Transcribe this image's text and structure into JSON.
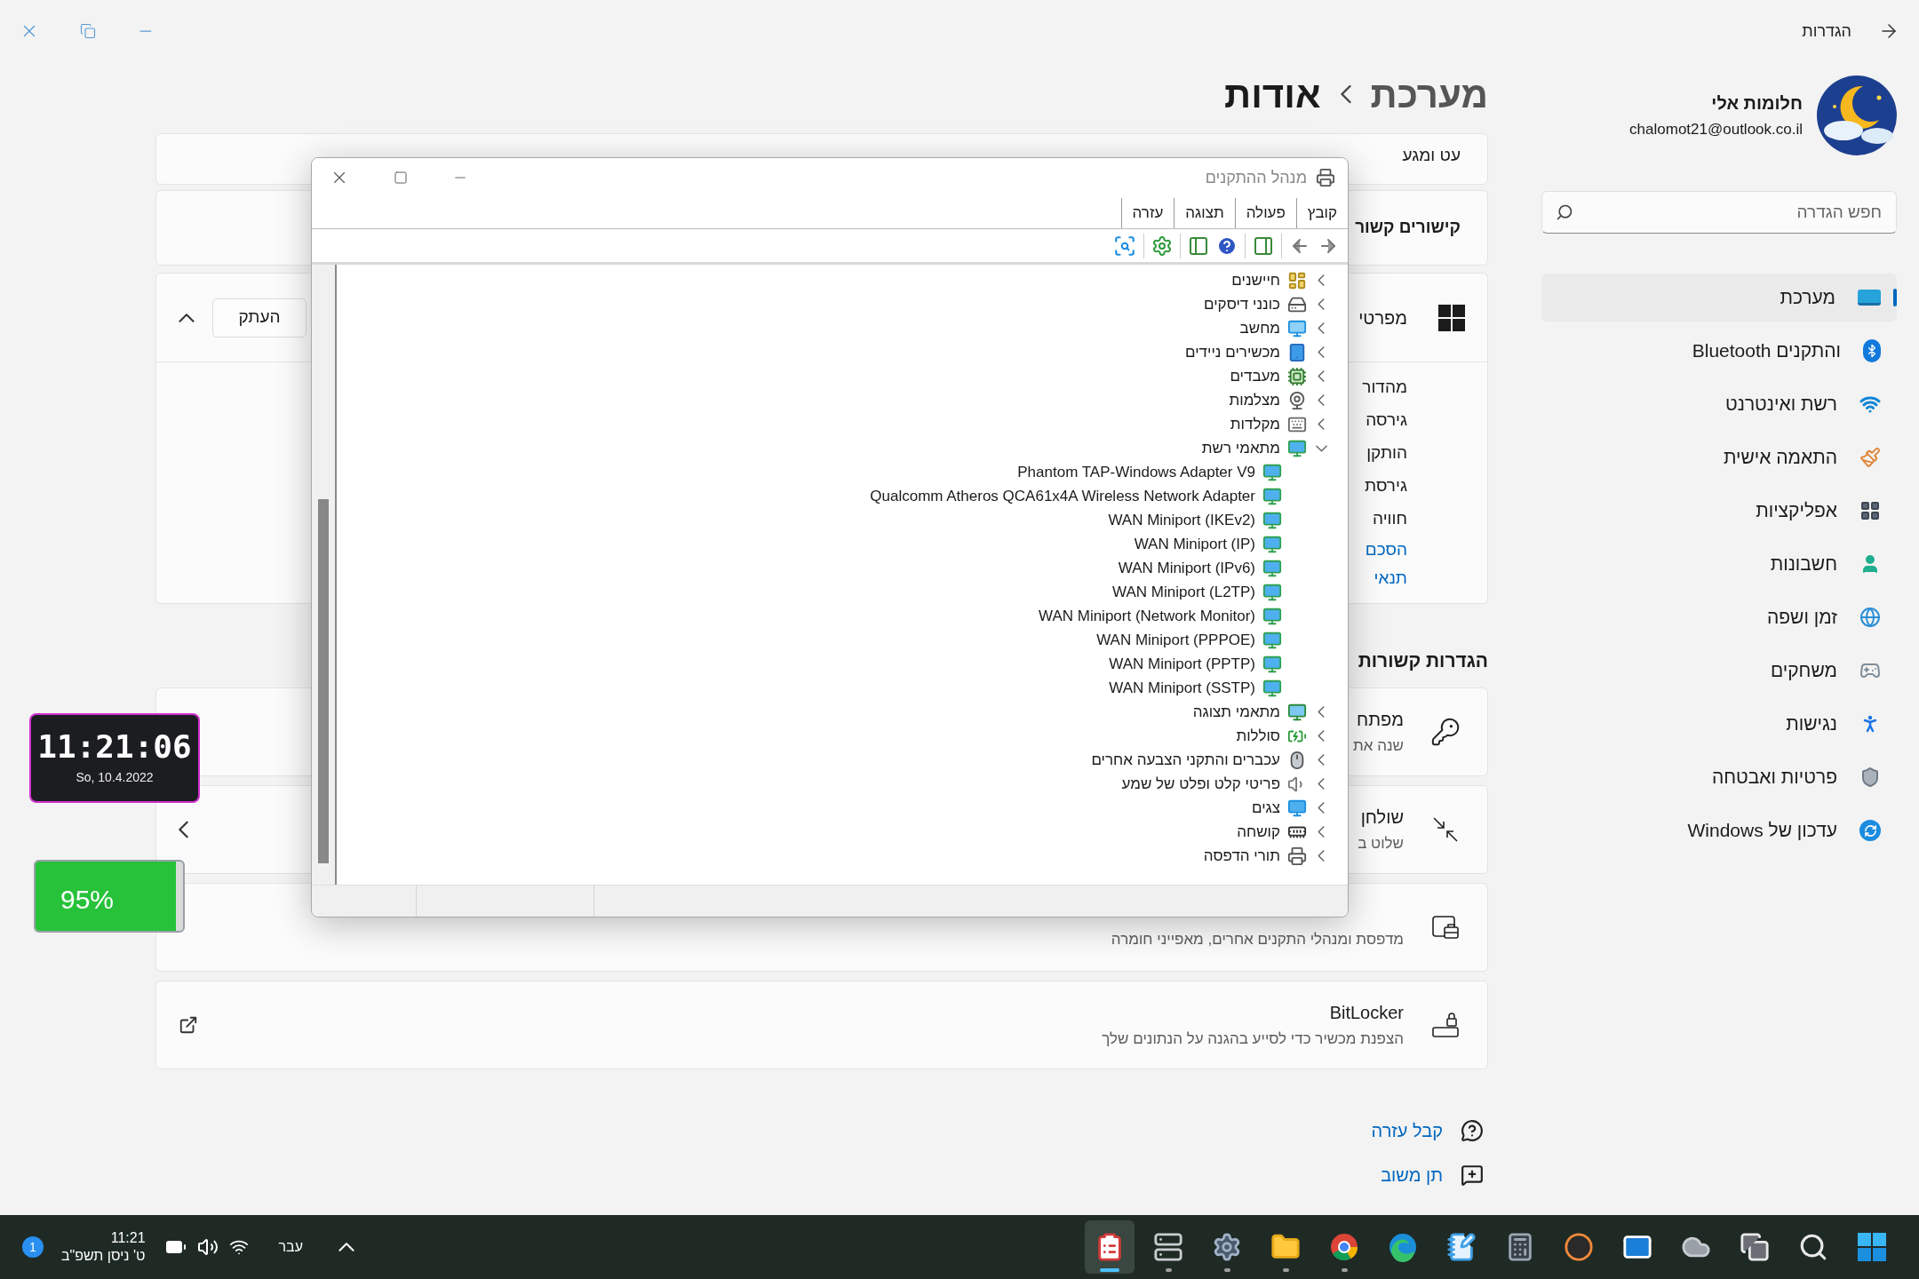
{
  "window": {
    "title": "הגדרות"
  },
  "profile": {
    "name": "חלומות אלי",
    "email": "chalomot21@outlook.co.il"
  },
  "search": {
    "placeholder": "חפש הגדרה"
  },
  "nav": [
    {
      "kind": "system",
      "label": "מערכת",
      "selected": true
    },
    {
      "kind": "bluetooth",
      "label": "Bluetooth והתקנים",
      "selected": false
    },
    {
      "kind": "network",
      "label": "רשת ואינטרנט",
      "selected": false
    },
    {
      "kind": "personalization",
      "label": "התאמה אישית",
      "selected": false
    },
    {
      "kind": "apps",
      "label": "אפליקציות",
      "selected": false
    },
    {
      "kind": "accounts",
      "label": "חשבונות",
      "selected": false
    },
    {
      "kind": "time",
      "label": "זמן ושפה",
      "selected": false
    },
    {
      "kind": "gaming",
      "label": "משחקים",
      "selected": false
    },
    {
      "kind": "accessibility",
      "label": "נגישות",
      "selected": false
    },
    {
      "kind": "privacy",
      "label": "פרטיות ואבטחה",
      "selected": false
    },
    {
      "kind": "update",
      "label": "עדכון של Windows",
      "selected": false
    }
  ],
  "breadcrumb": {
    "parent": "מערכת",
    "current": "אודות"
  },
  "pen_card": {
    "title": "עט ומגע"
  },
  "links_card": {
    "title": "קישורים קשור"
  },
  "specs": {
    "title": "מפרטי",
    "copy_button": "העתק",
    "expanded": true,
    "rows": [
      "מהדור",
      "גירסה",
      "הותקן",
      "גירסת",
      "חוויה"
    ],
    "links": [
      "הסכם",
      "תנאי"
    ]
  },
  "related_settings": {
    "heading": "הגדרות קשורות",
    "items": [
      {
        "kind": "key",
        "title": "מפתח",
        "subtitle": "שנה את"
      },
      {
        "kind": "remote",
        "title": "שולחן",
        "subtitle": "שלוט ב"
      },
      {
        "kind": "device-manager",
        "subtitle": "מדפסת ומנהלי התקנים אחרים, מאפייני חומרה"
      },
      {
        "kind": "bitlocker",
        "title": "BitLocker",
        "subtitle": "הצפנת מכשיר כדי לסייע בהגנה על הנתונים שלך"
      }
    ]
  },
  "help_links": [
    {
      "kind": "help",
      "label": "קבל עזרה"
    },
    {
      "kind": "feedback",
      "label": "תן משוב"
    }
  ],
  "device_manager": {
    "title": "מנהל ההתקנים",
    "menu": [
      "קובץ",
      "פעולה",
      "תצוגה",
      "עזרה"
    ],
    "tree": [
      {
        "kind": "sensor",
        "label": "חיישנים",
        "expanded": false
      },
      {
        "kind": "disk",
        "label": "כונני דיסקים",
        "expanded": false
      },
      {
        "kind": "computer",
        "label": "מחשב",
        "expanded": false
      },
      {
        "kind": "portable",
        "label": "מכשירים ניידים",
        "expanded": false
      },
      {
        "kind": "processor",
        "label": "מעבדים",
        "expanded": false
      },
      {
        "kind": "camera",
        "label": "מצלמות",
        "expanded": false
      },
      {
        "kind": "keyboard",
        "label": "מקלדות",
        "expanded": false
      },
      {
        "kind": "network",
        "label": "מתאמי רשת",
        "expanded": true,
        "children": [
          {
            "kind": "network",
            "label": "Phantom TAP-Windows Adapter V9"
          },
          {
            "kind": "network",
            "label": "Qualcomm Atheros QCA61x4A Wireless Network Adapter"
          },
          {
            "kind": "network",
            "label": "WAN Miniport (IKEv2)"
          },
          {
            "kind": "network",
            "label": "WAN Miniport (IP)"
          },
          {
            "kind": "network",
            "label": "WAN Miniport (IPv6)"
          },
          {
            "kind": "network",
            "label": "WAN Miniport (L2TP)"
          },
          {
            "kind": "network",
            "label": "WAN Miniport (Network Monitor)"
          },
          {
            "kind": "network",
            "label": "WAN Miniport (PPPOE)"
          },
          {
            "kind": "network",
            "label": "WAN Miniport (PPTP)"
          },
          {
            "kind": "network",
            "label": "WAN Miniport (SSTP)"
          }
        ]
      },
      {
        "kind": "display",
        "label": "מתאמי תצוגה",
        "expanded": false
      },
      {
        "kind": "battery",
        "label": "סוללות",
        "expanded": false
      },
      {
        "kind": "mouse",
        "label": "עכברים והתקני הצבעה אחרים",
        "expanded": false
      },
      {
        "kind": "audio",
        "label": "פריטי קלט ופלט של שמע",
        "expanded": false
      },
      {
        "kind": "monitor",
        "label": "צגים",
        "expanded": false
      },
      {
        "kind": "firmware",
        "label": "קושחה",
        "expanded": false
      },
      {
        "kind": "printer",
        "label": "תורי הדפסה",
        "expanded": false
      }
    ]
  },
  "widgets": {
    "clock": {
      "time": "11:21:06",
      "date": "So, 10.4.2022"
    },
    "battery": {
      "reading": "95%",
      "level": 0.95
    }
  },
  "taskbar": {
    "notifications": "1",
    "time": "11:21",
    "date": "ט' ניסן תשפ\"ב",
    "language": "עבר",
    "apps": [
      {
        "kind": "device-manager",
        "running": true,
        "selected": true
      },
      {
        "kind": "devices",
        "running": true,
        "selected": false
      },
      {
        "kind": "settings",
        "running": true,
        "selected": false
      },
      {
        "kind": "explorer",
        "running": true,
        "selected": false
      },
      {
        "kind": "chrome",
        "running": true,
        "selected": false
      },
      {
        "kind": "edge",
        "running": false,
        "selected": false
      },
      {
        "kind": "notepad",
        "running": false,
        "selected": false
      },
      {
        "kind": "calculator",
        "running": false,
        "selected": false
      },
      {
        "kind": "media",
        "running": false,
        "selected": false
      },
      {
        "kind": "mail",
        "running": false,
        "selected": false
      },
      {
        "kind": "weather",
        "running": false,
        "selected": false
      },
      {
        "kind": "taskview",
        "running": false,
        "selected": false
      },
      {
        "kind": "search",
        "running": false,
        "selected": false
      },
      {
        "kind": "start",
        "running": false,
        "selected": false
      }
    ]
  }
}
